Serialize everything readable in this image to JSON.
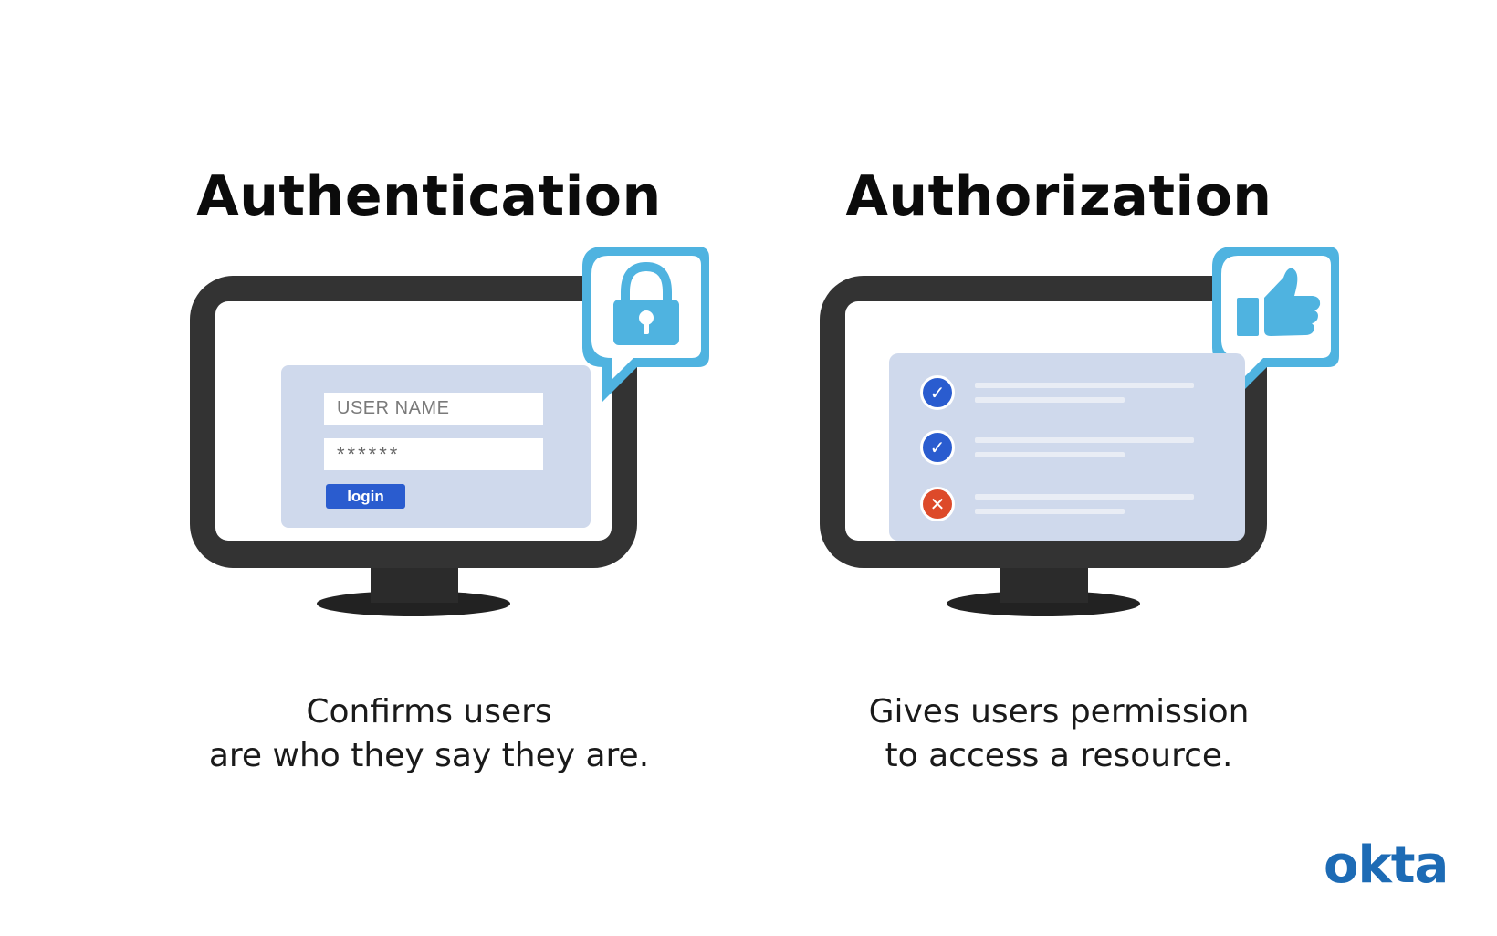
{
  "authentication": {
    "title": "Authentication",
    "caption_line1": "Confirms users",
    "caption_line2": "are who they say they are.",
    "username_placeholder": "USER NAME",
    "password_mask": "******",
    "login_label": "login",
    "badge_icon": "lock-icon"
  },
  "authorization": {
    "title": "Authorization",
    "caption_line1": "Gives users permission",
    "caption_line2": "to access a resource.",
    "badge_icon": "thumbs-up-icon",
    "permissions": [
      {
        "status": "granted",
        "icon": "check-icon",
        "glyph": "✓"
      },
      {
        "status": "granted",
        "icon": "check-icon",
        "glyph": "✓"
      },
      {
        "status": "denied",
        "icon": "x-icon",
        "glyph": "✕"
      }
    ]
  },
  "brand": {
    "logo_text": "okta"
  },
  "colors": {
    "monitor_frame": "#333333",
    "badge_blue": "#4fb3e0",
    "card_bg": "#cfd9ec",
    "button_blue": "#2a5ccf",
    "denied_red": "#dd4a2a",
    "logo_blue": "#1d6bb5"
  }
}
